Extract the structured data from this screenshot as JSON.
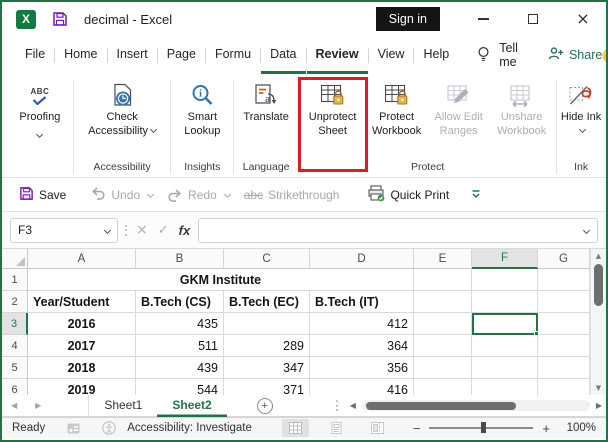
{
  "titlebar": {
    "title": "decimal - Excel",
    "sign_in_label": "Sign in"
  },
  "menubar": {
    "tabs": [
      {
        "label": "File"
      },
      {
        "label": "Home"
      },
      {
        "label": "Insert"
      },
      {
        "label": "Page"
      },
      {
        "label": "Formu"
      },
      {
        "label": "Data",
        "underline": true
      },
      {
        "label": "Review",
        "active": true
      },
      {
        "label": "View"
      },
      {
        "label": "Help"
      }
    ],
    "tell_me_label": "Tell me",
    "share_label": "Share"
  },
  "ribbon": {
    "buttons": {
      "proofing": {
        "label": "Proofing"
      },
      "check_accessibility": {
        "label": "Check Accessibility"
      },
      "smart_lookup": {
        "label": "Smart Lookup"
      },
      "translate": {
        "label": "Translate"
      },
      "unprotect_sheet": {
        "label": "Unprotect Sheet",
        "highlighted": true
      },
      "protect_workbook": {
        "label": "Protect Workbook"
      },
      "allow_edit_ranges": {
        "label": "Allow Edit Ranges",
        "disabled": true
      },
      "unshare_workbook": {
        "label": "Unshare Workbook",
        "disabled": true
      },
      "hide_ink": {
        "label": "Hide Ink"
      }
    },
    "group_labels": {
      "accessibility": "Accessibility",
      "insights": "Insights",
      "language": "Language",
      "protect": "Protect",
      "ink": "Ink"
    }
  },
  "quick_access": {
    "save_label": "Save",
    "undo_label": "Undo",
    "redo_label": "Redo",
    "strikethrough_label": "Strikethrough",
    "quick_print_label": "Quick Print"
  },
  "formula_bar": {
    "name_box": "F3",
    "fx_label": "fx",
    "formula_value": ""
  },
  "sheet": {
    "columns": [
      "A",
      "B",
      "C",
      "D",
      "E",
      "F",
      "G"
    ],
    "selected_cell": {
      "column": "F",
      "row": 3
    },
    "rows": [
      {
        "n": "1",
        "cells": [
          {
            "c": "A",
            "v": "GKM Institute",
            "span": 4,
            "bold": true,
            "align": "center"
          }
        ]
      },
      {
        "n": "2",
        "cells": [
          {
            "c": "A",
            "v": "Year/Student",
            "bold": true
          },
          {
            "c": "B",
            "v": "B.Tech (CS)",
            "bold": true
          },
          {
            "c": "C",
            "v": "B.Tech (EC)",
            "bold": true
          },
          {
            "c": "D",
            "v": "B.Tech (IT)",
            "bold": true
          }
        ]
      },
      {
        "n": "3",
        "cells": [
          {
            "c": "A",
            "v": "2016",
            "bold": true,
            "align": "center"
          },
          {
            "c": "B",
            "v": "435",
            "align": "right"
          },
          {
            "c": "D",
            "v": "412",
            "align": "right"
          }
        ]
      },
      {
        "n": "4",
        "cells": [
          {
            "c": "A",
            "v": "2017",
            "bold": true,
            "align": "center"
          },
          {
            "c": "B",
            "v": "511",
            "align": "right"
          },
          {
            "c": "C",
            "v": "289",
            "align": "right"
          },
          {
            "c": "D",
            "v": "364",
            "align": "right"
          }
        ]
      },
      {
        "n": "5",
        "cells": [
          {
            "c": "A",
            "v": "2018",
            "bold": true,
            "align": "center"
          },
          {
            "c": "B",
            "v": "439",
            "align": "right"
          },
          {
            "c": "C",
            "v": "347",
            "align": "right"
          },
          {
            "c": "D",
            "v": "356",
            "align": "right"
          }
        ]
      },
      {
        "n": "6",
        "cells": [
          {
            "c": "A",
            "v": "2019",
            "bold": true,
            "align": "center"
          },
          {
            "c": "B",
            "v": "544",
            "align": "right"
          },
          {
            "c": "C",
            "v": "371",
            "align": "right"
          },
          {
            "c": "D",
            "v": "416",
            "align": "right"
          }
        ]
      }
    ]
  },
  "sheet_tabs": {
    "items": [
      {
        "label": "Sheet1"
      },
      {
        "label": "Sheet2",
        "active": true
      }
    ]
  },
  "status_bar": {
    "ready_label": "Ready",
    "accessibility_label": "Accessibility: Investigate",
    "zoom_level": "100%"
  },
  "colors": {
    "excel_green": "#217346",
    "highlight_red": "#E11B22",
    "lock_gold": "#E8B64C"
  }
}
